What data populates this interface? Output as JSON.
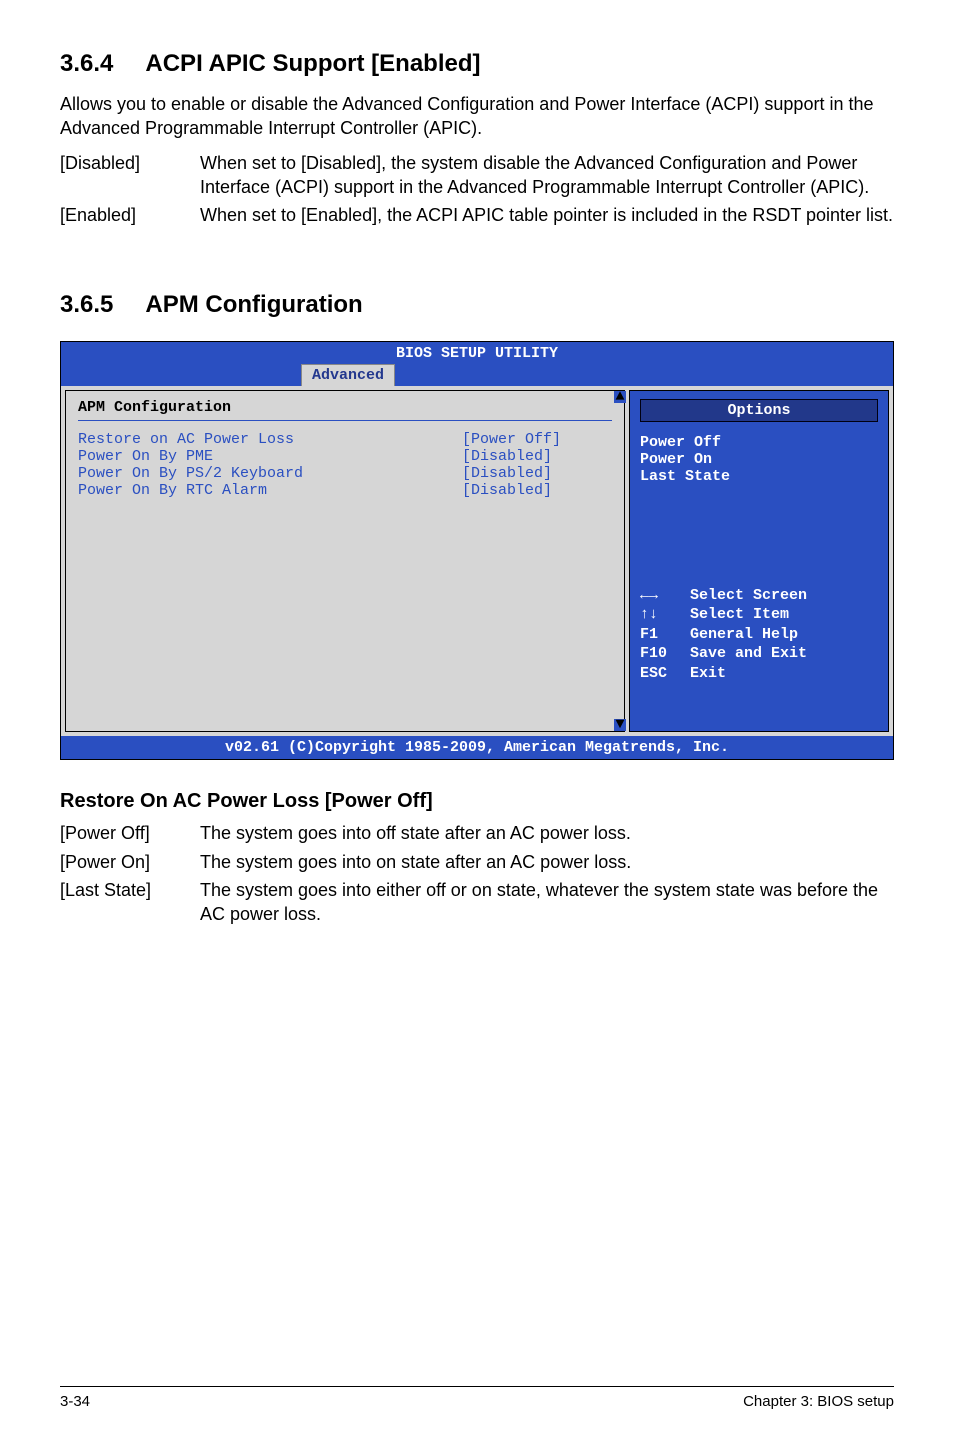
{
  "sec364": {
    "num": "3.6.4",
    "title": "ACPI APIC Support [Enabled]",
    "desc": "Allows you to enable or disable the Advanced Configuration and Power Interface (ACPI) support in the Advanced Programmable Interrupt Controller (APIC).",
    "opts": [
      {
        "label": "[Disabled]",
        "text": "When set to [Disabled], the system disable the Advanced Configuration and Power Interface (ACPI) support in the Advanced Programmable Interrupt Controller (APIC)."
      },
      {
        "label": "[Enabled]",
        "text": "When set to [Enabled], the ACPI APIC table pointer is included in the RSDT pointer list."
      }
    ]
  },
  "sec365": {
    "num": "3.6.5",
    "title": "APM Configuration"
  },
  "bios": {
    "header_title": "BIOS SETUP UTILITY",
    "tab": "Advanced",
    "left": {
      "cfg_title": "APM Configuration",
      "rows": [
        {
          "lbl": "Restore on AC Power Loss",
          "val": "[Power Off]"
        },
        {
          "lbl": "Power On By PME",
          "val": "[Disabled]"
        },
        {
          "lbl": "Power On By PS/2 Keyboard",
          "val": "[Disabled]"
        },
        {
          "lbl": "Power On By RTC Alarm",
          "val": "[Disabled]"
        }
      ]
    },
    "right": {
      "options_header": "Options",
      "opts": [
        "Power Off",
        "Power On",
        "Last State"
      ],
      "help": [
        {
          "k": "←→",
          "t": "Select Screen"
        },
        {
          "k": "↑↓",
          "t": "Select Item"
        },
        {
          "k": "F1",
          "t": "General Help"
        },
        {
          "k": "F10",
          "t": "Save and Exit"
        },
        {
          "k": "ESC",
          "t": "Exit"
        }
      ]
    },
    "footer": "v02.61 (C)Copyright 1985-2009, American Megatrends, Inc."
  },
  "restore": {
    "heading": "Restore On AC Power Loss [Power Off]",
    "opts": [
      {
        "label": "[Power Off]",
        "text": "The system goes into off state after an AC power loss."
      },
      {
        "label": "[Power On]",
        "text": "The system goes into on state after an AC power loss."
      },
      {
        "label": "[Last State]",
        "text": "The system goes into either off or on state, whatever the system state was before the AC power loss."
      }
    ]
  },
  "footer": {
    "left": "3-34",
    "right": "Chapter 3: BIOS setup"
  }
}
